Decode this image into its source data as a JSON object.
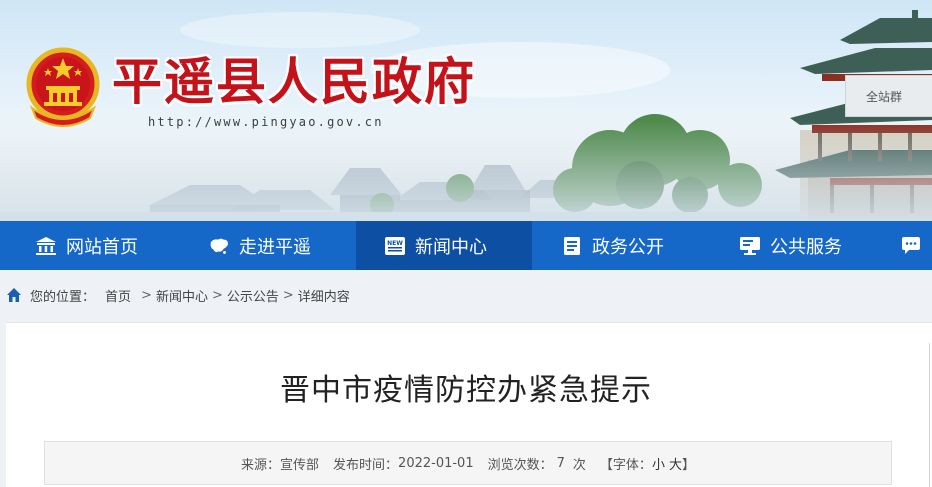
{
  "header": {
    "site_title": "平遥县人民政府",
    "site_url": "http://www.pingyao.gov.cn",
    "search_button": "全站群",
    "colors": {
      "title_red": "#c4121a",
      "nav_blue": "#1568c7",
      "nav_active": "#0d4fa3"
    }
  },
  "nav": {
    "items": [
      {
        "label": "网站首页",
        "icon": "bank-icon"
      },
      {
        "label": "走进平遥",
        "icon": "china-map-icon"
      },
      {
        "label": "新闻中心",
        "icon": "newspaper-icon",
        "active": true
      },
      {
        "label": "政务公开",
        "icon": "document-icon"
      },
      {
        "label": "公共服务",
        "icon": "monitor-icon"
      },
      {
        "label": "",
        "icon": "chat-bubble-icon"
      }
    ]
  },
  "breadcrumb": {
    "prefix": "您的位置：",
    "items": [
      "首页",
      "新闻中心",
      "公示公告",
      "详细内容"
    ],
    "separator": ">"
  },
  "article": {
    "title": "晋中市疫情防控办紧急提示",
    "source_label": "来源：",
    "source": "宣传部",
    "date_label": "发布时间：",
    "date": "2022-01-01",
    "views_label": "浏览次数：",
    "views": "7",
    "views_unit": "次",
    "font_label": "【字体：",
    "font_small": "小",
    "font_large": "大",
    "font_close": "】"
  }
}
